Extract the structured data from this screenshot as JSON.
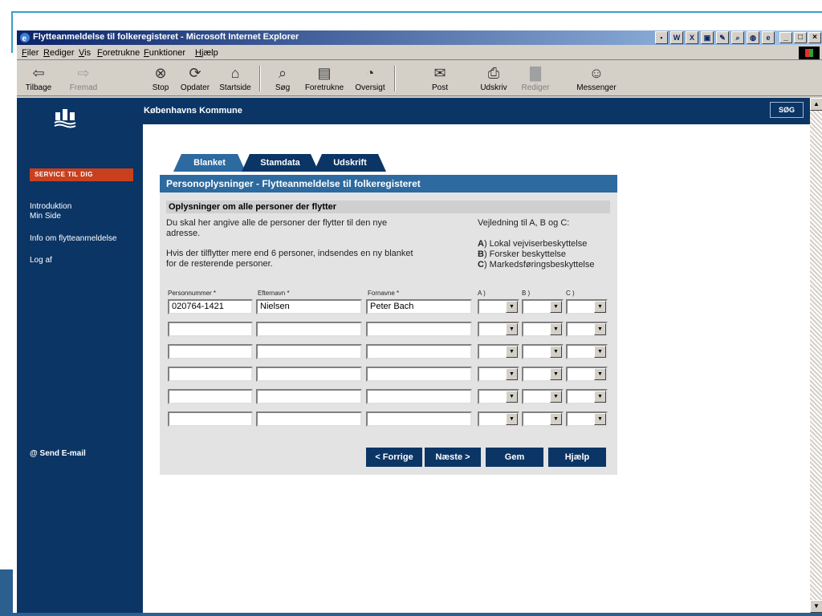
{
  "window": {
    "title": "Flytteanmeldelse til folkeregisteret - Microsoft Internet Explorer"
  },
  "menu": [
    "Filer",
    "Rediger",
    "Vis",
    "Foretrukne",
    "Funktioner",
    "Hjælp"
  ],
  "toolbar": {
    "back": "Tilbage",
    "forward": "Fremad",
    "stop": "Stop",
    "refresh": "Opdater",
    "home": "Startside",
    "search": "Søg",
    "favorites": "Foretrukne",
    "history": "Oversigt",
    "mail": "Post",
    "print": "Udskriv",
    "edit": "Rediger",
    "messenger": "Messenger"
  },
  "site": {
    "org_name": "Københavns Kommune",
    "search_button": "SØG",
    "service_badge": "SERVICE TIL DIG",
    "nav": [
      "Introduktion",
      "Min Side",
      "Info om flytteanmeldelse",
      "Log af"
    ],
    "send_email": "@ Send E-mail"
  },
  "tabs": [
    "Blanket",
    "Stamdata",
    "Udskrift"
  ],
  "form": {
    "panel_title": "Personoplysninger - Flytteanmeldelse til folkeregisteret",
    "section_title": "Oplysninger om alle personer der flytter",
    "desc1_line1": "Du skal her angive alle de personer der flytter til den nye",
    "desc1_line2": "adresse.",
    "desc2_line1": "Hvis der tilflytter mere end 6 personer, indsendes en ny blanket",
    "desc2_line2": "for de resterende personer.",
    "guide_title": "Vejledning til A, B og C:",
    "guide_a_key": "A",
    "guide_a": ") Lokal vejviserbeskyttelse",
    "guide_b_key": "B",
    "guide_b": ") Forsker beskyttelse",
    "guide_c_key": "C",
    "guide_c": ") Markedsføringsbeskyttelse",
    "columns": {
      "cpr": "Personnummer *",
      "surname": "Efternavn *",
      "firstnames": "Fornavne *",
      "a": "A )",
      "b": "B )",
      "c": "C )"
    },
    "rows": [
      {
        "cpr": "020764-1421",
        "surname": "Nielsen",
        "firstnames": "Peter Bach"
      },
      {
        "cpr": "",
        "surname": "",
        "firstnames": ""
      },
      {
        "cpr": "",
        "surname": "",
        "firstnames": ""
      },
      {
        "cpr": "",
        "surname": "",
        "firstnames": ""
      },
      {
        "cpr": "",
        "surname": "",
        "firstnames": ""
      },
      {
        "cpr": "",
        "surname": "",
        "firstnames": ""
      }
    ],
    "buttons": {
      "prev": "< Forrige",
      "next": "Næste >",
      "save": "Gem",
      "help": "Hjælp"
    }
  },
  "colors": {
    "navy": "#0b3565",
    "tab_active": "#2c6aa0",
    "service_badge": "#c9401e"
  }
}
